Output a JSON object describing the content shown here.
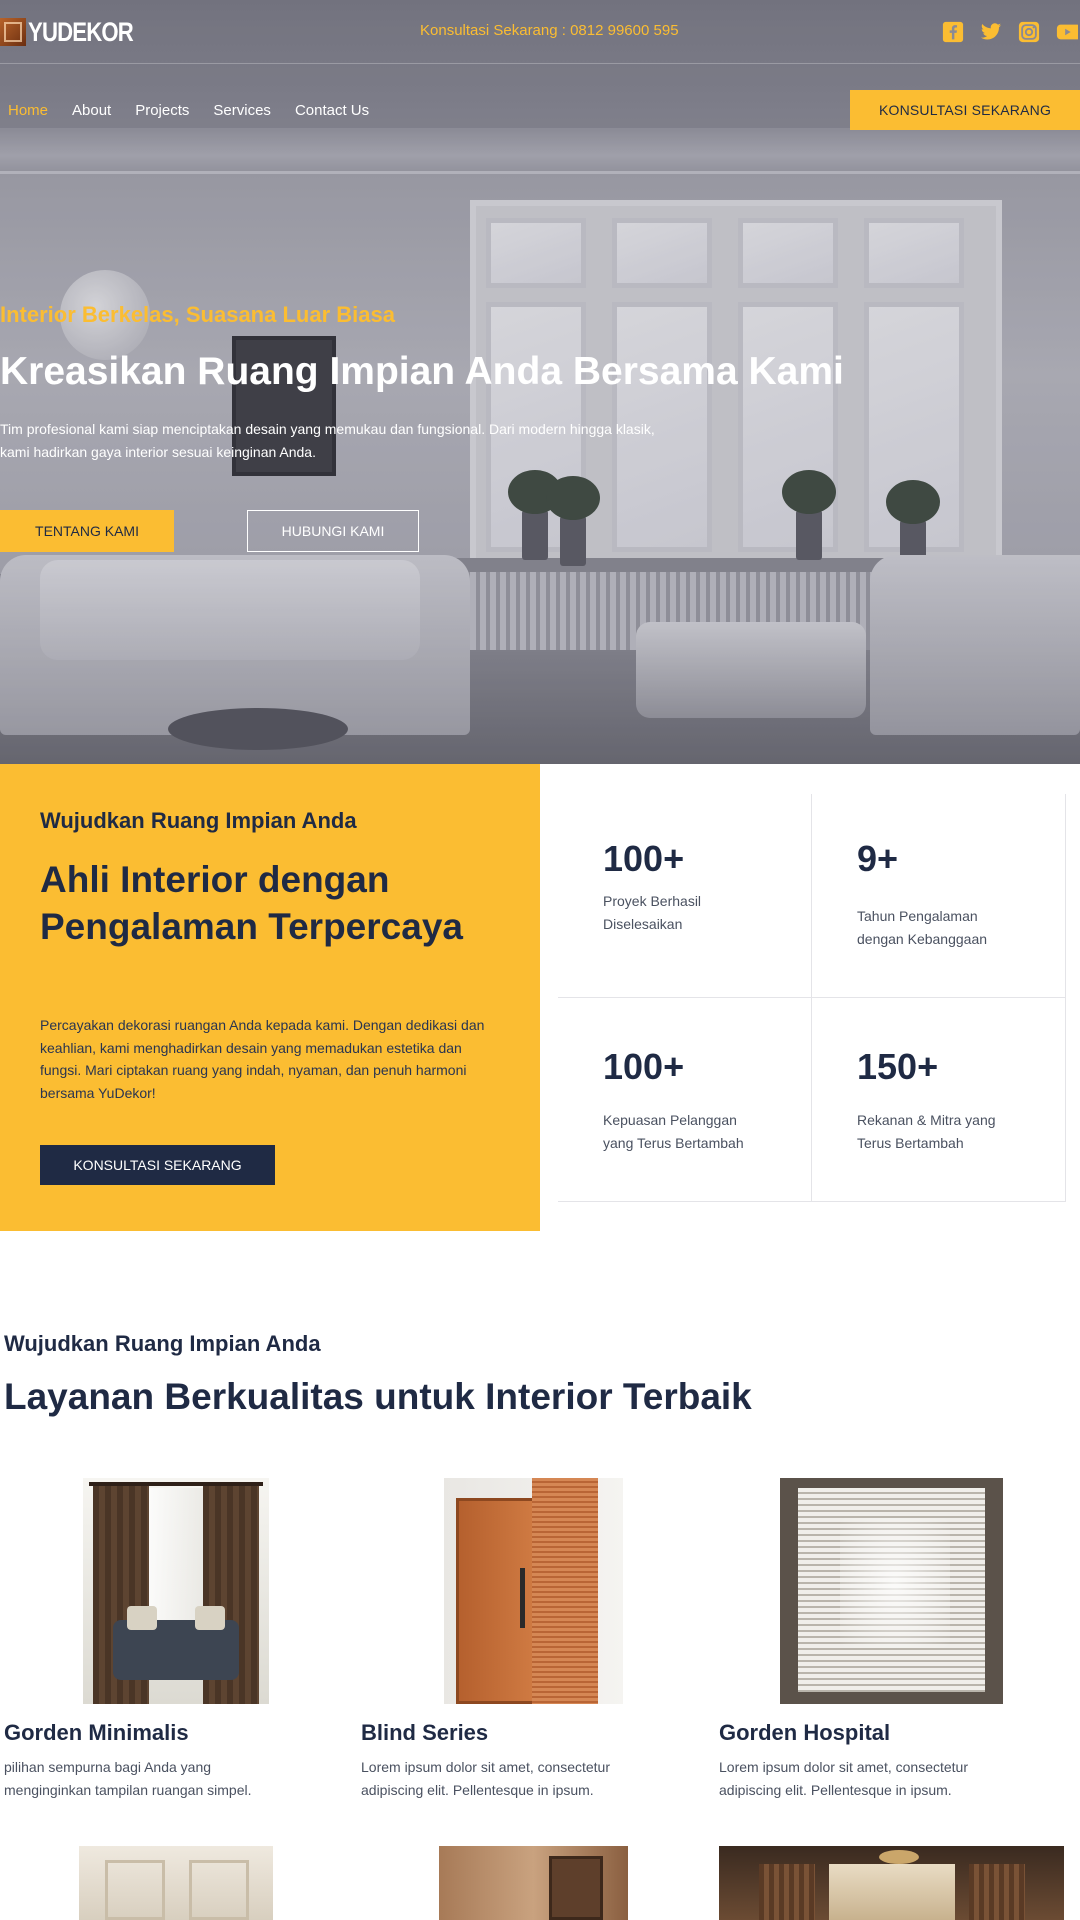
{
  "brand": {
    "logo_text": "YUDEKOR"
  },
  "topbar": {
    "contact": "Konsultasi Sekarang : 0812 99600 595",
    "socials": [
      "facebook-icon",
      "twitter-icon",
      "instagram-icon",
      "youtube-icon"
    ]
  },
  "nav": {
    "items": [
      {
        "label": "Home"
      },
      {
        "label": "About"
      },
      {
        "label": "Projects"
      },
      {
        "label": "Services"
      },
      {
        "label": "Contact Us"
      }
    ],
    "cta": "KONSULTASI SEKARANG"
  },
  "hero": {
    "subtitle": "Interior Berkelas, Suasana Luar Biasa",
    "title": "Kreasikan Ruang Impian Anda Bersama Kami",
    "description_line1": "Tim profesional kami siap menciptakan desain yang memukau dan fungsional. Dari modern hingga klasik,",
    "description_line2": "kami hadirkan gaya interior sesuai keinginan Anda.",
    "btn_primary": "TENTANG KAMI",
    "btn_secondary": "HUBUNGI KAMI"
  },
  "about": {
    "subtitle": "Wujudkan Ruang Impian Anda",
    "title": "Ahli Interior dengan Pengalaman Terpercaya",
    "description": "Percayakan dekorasi ruangan Anda kepada kami. Dengan dedikasi dan keahlian, kami menghadirkan desain yang memadukan estetika dan fungsi. Mari ciptakan ruang yang indah, nyaman, dan penuh harmoni bersama YuDekor!",
    "button": "KONSULTASI SEKARANG"
  },
  "stats": [
    {
      "value": "100+",
      "label": "Proyek Berhasil Diselesaikan"
    },
    {
      "value": "9+",
      "label": "Tahun Pengalaman dengan Kebanggaan"
    },
    {
      "value": "100+",
      "label": "Kepuasan Pelanggan yang Terus Bertambah"
    },
    {
      "value": "150+",
      "label": "Rekanan & Mitra yang Terus Bertambah"
    }
  ],
  "services": {
    "subtitle": "Wujudkan Ruang Impian Anda",
    "title": "Layanan Berkualitas untuk Interior Terbaik",
    "cards": [
      {
        "title": "Gorden Minimalis",
        "description": "pilihan sempurna bagi Anda yang menginginkan tampilan ruangan simpel."
      },
      {
        "title": "Blind Series",
        "description": "Lorem ipsum dolor sit amet, consectetur adipiscing elit. Pellentesque in ipsum."
      },
      {
        "title": "Gorden Hospital",
        "description": "Lorem ipsum dolor sit amet, consectetur adipiscing elit. Pellentesque in ipsum."
      }
    ]
  },
  "colors": {
    "accent": "#fbbd32",
    "navy": "#1f2a44",
    "text": "#4a5160"
  }
}
